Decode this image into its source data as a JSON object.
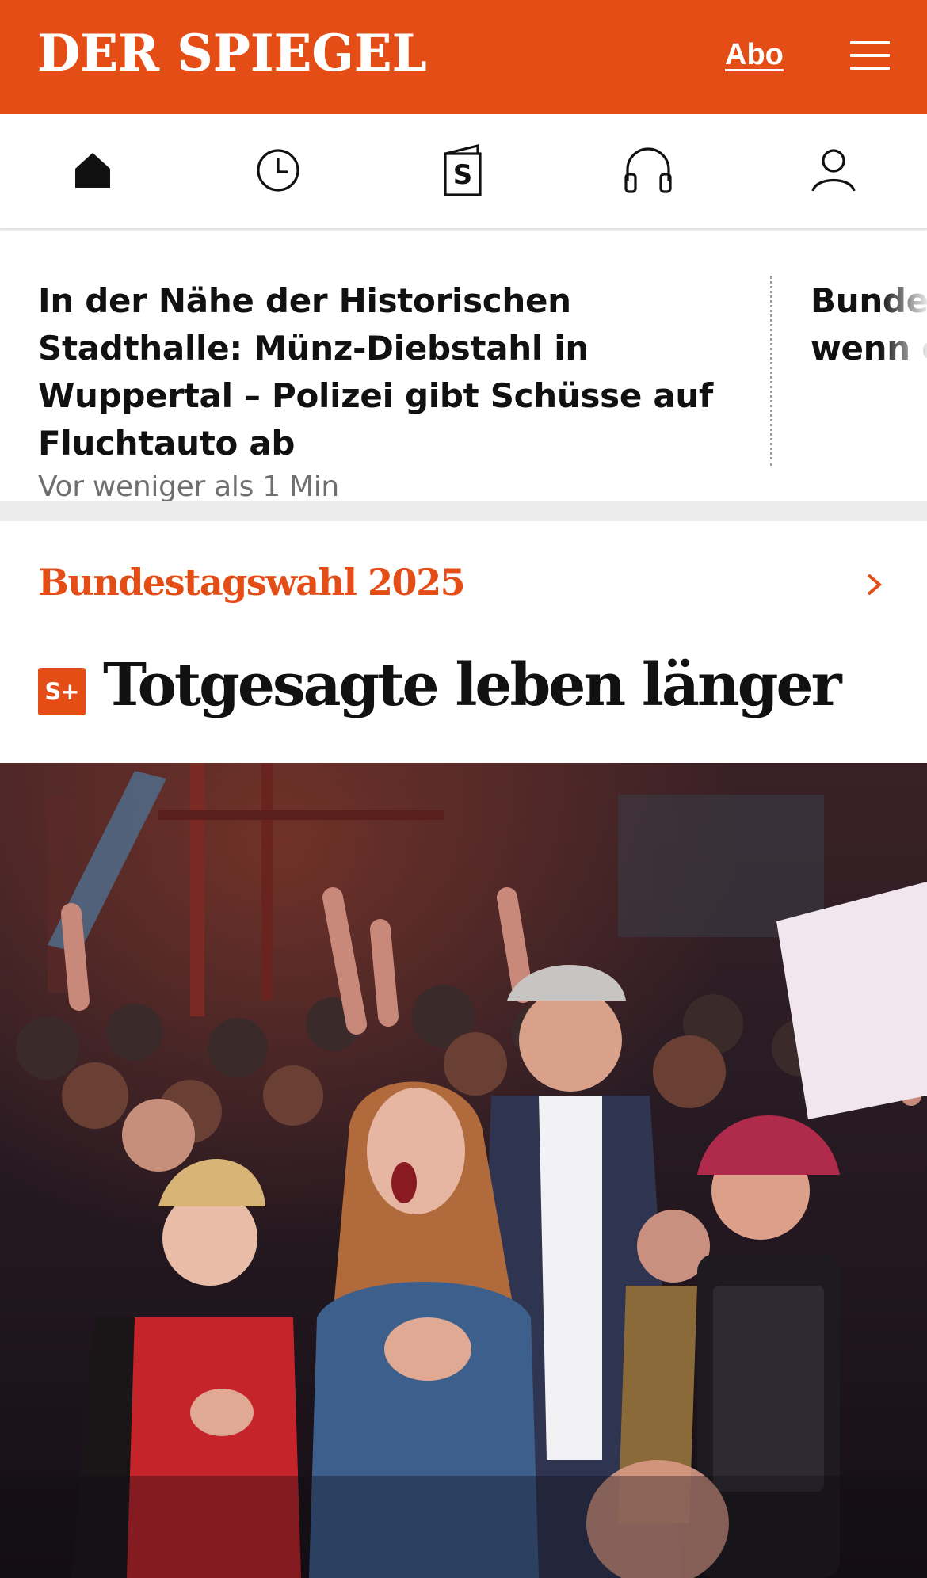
{
  "header": {
    "logo": "DER SPIEGEL",
    "abo_label": "Abo",
    "brand_color": "#e44d15"
  },
  "icon_nav": [
    {
      "icon": "home-icon"
    },
    {
      "icon": "clock-icon"
    },
    {
      "icon": "spiegel-edition-icon",
      "glyph": "S"
    },
    {
      "icon": "headphones-icon"
    },
    {
      "icon": "user-icon"
    }
  ],
  "ticker": {
    "items": [
      {
        "title": "In der Nähe der Historischen Stadthalle: Münz-Diebstahl in Wuppertal – Polizei gibt Schüsse auf Fluchtauto ab",
        "time": "Vor weniger als 1 Min"
      },
      {
        "title": "Bundes kündig wenn einzieh"
      }
    ]
  },
  "section": {
    "title": "Bundestagswahl 2025"
  },
  "lead": {
    "badge": "S+",
    "headline": "Totgesagte leben länger"
  }
}
